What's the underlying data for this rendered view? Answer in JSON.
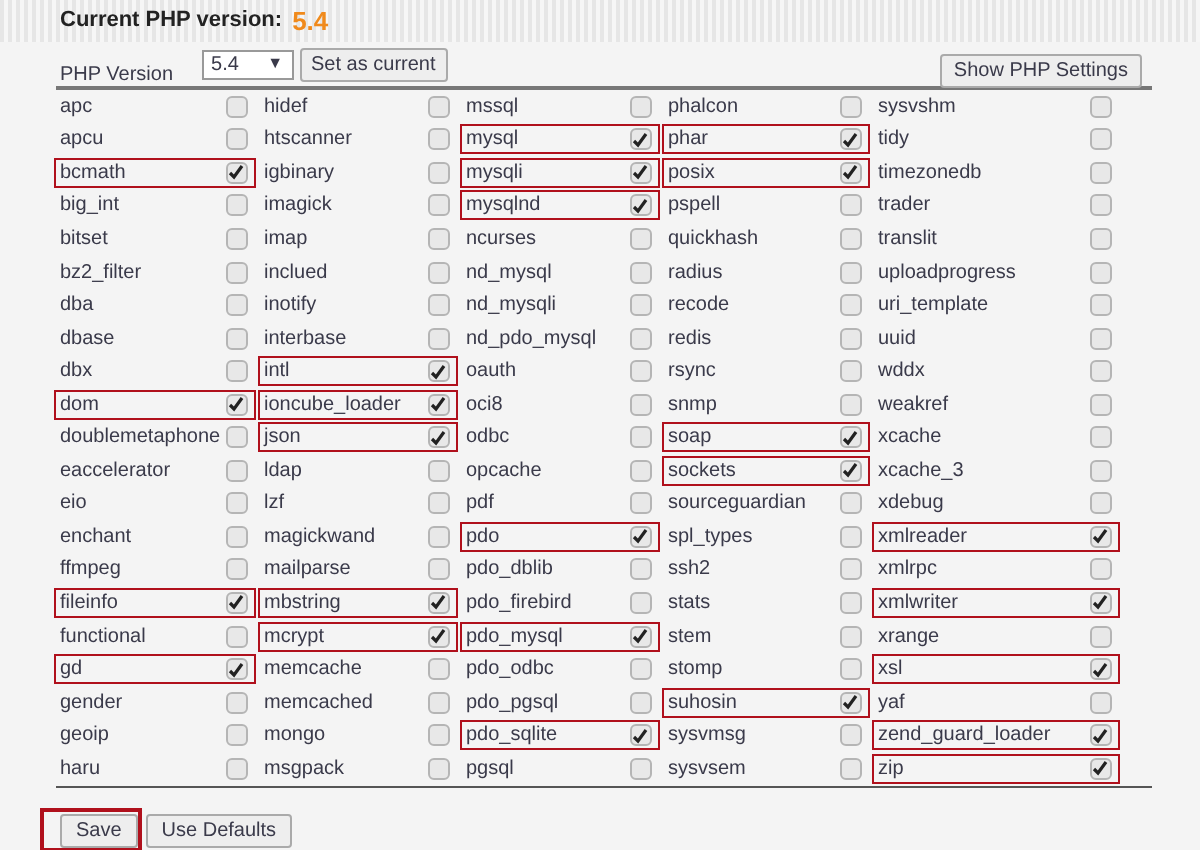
{
  "header": {
    "label": "Current PHP version:",
    "version": "5.4"
  },
  "version_selector": {
    "label": "PHP Version",
    "value": "5.4",
    "arrow": "▼",
    "set_button": "Set as current"
  },
  "show_settings_button": "Show PHP Settings",
  "extensions": [
    {
      "name": "apc",
      "checked": false
    },
    {
      "name": "apcu",
      "checked": false
    },
    {
      "name": "bcmath",
      "checked": true
    },
    {
      "name": "big_int",
      "checked": false
    },
    {
      "name": "bitset",
      "checked": false
    },
    {
      "name": "bz2_filter",
      "checked": false
    },
    {
      "name": "dba",
      "checked": false
    },
    {
      "name": "dbase",
      "checked": false
    },
    {
      "name": "dbx",
      "checked": false
    },
    {
      "name": "dom",
      "checked": true
    },
    {
      "name": "doublemetaphone",
      "checked": false
    },
    {
      "name": "eaccelerator",
      "checked": false
    },
    {
      "name": "eio",
      "checked": false
    },
    {
      "name": "enchant",
      "checked": false
    },
    {
      "name": "ffmpeg",
      "checked": false
    },
    {
      "name": "fileinfo",
      "checked": true
    },
    {
      "name": "functional",
      "checked": false
    },
    {
      "name": "gd",
      "checked": true
    },
    {
      "name": "gender",
      "checked": false
    },
    {
      "name": "geoip",
      "checked": false
    },
    {
      "name": "haru",
      "checked": false
    },
    {
      "name": "hidef",
      "checked": false
    },
    {
      "name": "htscanner",
      "checked": false
    },
    {
      "name": "igbinary",
      "checked": false
    },
    {
      "name": "imagick",
      "checked": false
    },
    {
      "name": "imap",
      "checked": false
    },
    {
      "name": "inclued",
      "checked": false
    },
    {
      "name": "inotify",
      "checked": false
    },
    {
      "name": "interbase",
      "checked": false
    },
    {
      "name": "intl",
      "checked": true
    },
    {
      "name": "ioncube_loader",
      "checked": true
    },
    {
      "name": "json",
      "checked": true
    },
    {
      "name": "ldap",
      "checked": false
    },
    {
      "name": "lzf",
      "checked": false
    },
    {
      "name": "magickwand",
      "checked": false
    },
    {
      "name": "mailparse",
      "checked": false
    },
    {
      "name": "mbstring",
      "checked": true
    },
    {
      "name": "mcrypt",
      "checked": true
    },
    {
      "name": "memcache",
      "checked": false
    },
    {
      "name": "memcached",
      "checked": false
    },
    {
      "name": "mongo",
      "checked": false
    },
    {
      "name": "msgpack",
      "checked": false
    },
    {
      "name": "mssql",
      "checked": false
    },
    {
      "name": "mysql",
      "checked": true
    },
    {
      "name": "mysqli",
      "checked": true
    },
    {
      "name": "mysqlnd",
      "checked": true
    },
    {
      "name": "ncurses",
      "checked": false
    },
    {
      "name": "nd_mysql",
      "checked": false
    },
    {
      "name": "nd_mysqli",
      "checked": false
    },
    {
      "name": "nd_pdo_mysql",
      "checked": false
    },
    {
      "name": "oauth",
      "checked": false
    },
    {
      "name": "oci8",
      "checked": false
    },
    {
      "name": "odbc",
      "checked": false
    },
    {
      "name": "opcache",
      "checked": false
    },
    {
      "name": "pdf",
      "checked": false
    },
    {
      "name": "pdo",
      "checked": true
    },
    {
      "name": "pdo_dblib",
      "checked": false
    },
    {
      "name": "pdo_firebird",
      "checked": false
    },
    {
      "name": "pdo_mysql",
      "checked": true
    },
    {
      "name": "pdo_odbc",
      "checked": false
    },
    {
      "name": "pdo_pgsql",
      "checked": false
    },
    {
      "name": "pdo_sqlite",
      "checked": true
    },
    {
      "name": "pgsql",
      "checked": false
    },
    {
      "name": "phalcon",
      "checked": false
    },
    {
      "name": "phar",
      "checked": true
    },
    {
      "name": "posix",
      "checked": true
    },
    {
      "name": "pspell",
      "checked": false
    },
    {
      "name": "quickhash",
      "checked": false
    },
    {
      "name": "radius",
      "checked": false
    },
    {
      "name": "recode",
      "checked": false
    },
    {
      "name": "redis",
      "checked": false
    },
    {
      "name": "rsync",
      "checked": false
    },
    {
      "name": "snmp",
      "checked": false
    },
    {
      "name": "soap",
      "checked": true
    },
    {
      "name": "sockets",
      "checked": true
    },
    {
      "name": "sourceguardian",
      "checked": false
    },
    {
      "name": "spl_types",
      "checked": false
    },
    {
      "name": "ssh2",
      "checked": false
    },
    {
      "name": "stats",
      "checked": false
    },
    {
      "name": "stem",
      "checked": false
    },
    {
      "name": "stomp",
      "checked": false
    },
    {
      "name": "suhosin",
      "checked": true
    },
    {
      "name": "sysvmsg",
      "checked": false
    },
    {
      "name": "sysvsem",
      "checked": false
    },
    {
      "name": "sysvshm",
      "checked": false
    },
    {
      "name": "tidy",
      "checked": false
    },
    {
      "name": "timezonedb",
      "checked": false
    },
    {
      "name": "trader",
      "checked": false
    },
    {
      "name": "translit",
      "checked": false
    },
    {
      "name": "uploadprogress",
      "checked": false
    },
    {
      "name": "uri_template",
      "checked": false
    },
    {
      "name": "uuid",
      "checked": false
    },
    {
      "name": "wddx",
      "checked": false
    },
    {
      "name": "weakref",
      "checked": false
    },
    {
      "name": "xcache",
      "checked": false
    },
    {
      "name": "xcache_3",
      "checked": false
    },
    {
      "name": "xdebug",
      "checked": false
    },
    {
      "name": "xmlreader",
      "checked": true
    },
    {
      "name": "xmlrpc",
      "checked": false
    },
    {
      "name": "xmlwriter",
      "checked": true
    },
    {
      "name": "xrange",
      "checked": false
    },
    {
      "name": "xsl",
      "checked": true
    },
    {
      "name": "yaf",
      "checked": false
    },
    {
      "name": "zend_guard_loader",
      "checked": true
    },
    {
      "name": "zip",
      "checked": true
    }
  ],
  "buttons": [
    {
      "label": "Save",
      "highlighted": true
    },
    {
      "label": "Use Defaults",
      "highlighted": false
    }
  ]
}
